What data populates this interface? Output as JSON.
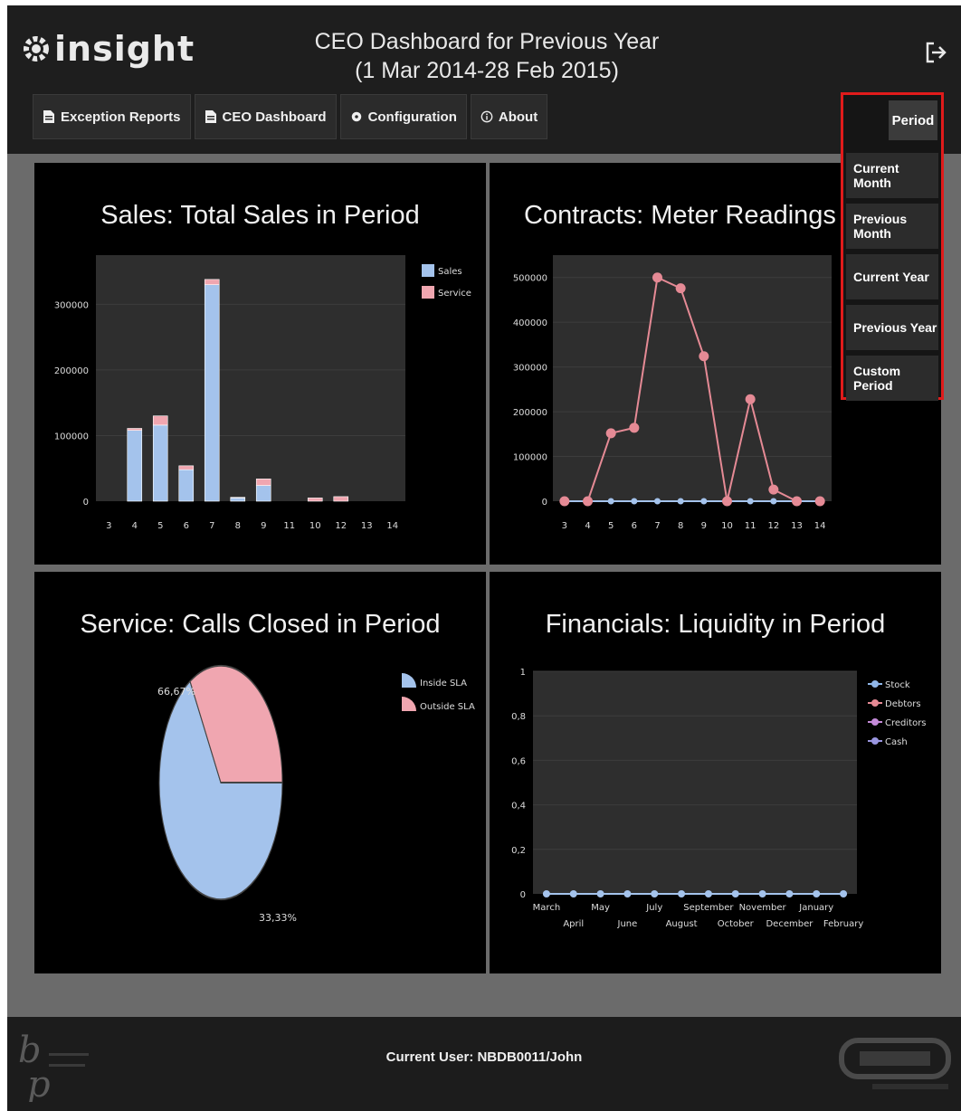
{
  "header": {
    "logo": "insight",
    "title_line1": "CEO Dashboard for Previous Year",
    "title_line2": "(1 Mar 2014-28 Feb 2015)"
  },
  "nav": [
    {
      "label": "Exception Reports",
      "icon": "document-icon"
    },
    {
      "label": "CEO Dashboard",
      "icon": "document-icon"
    },
    {
      "label": "Configuration",
      "icon": "gear-icon"
    },
    {
      "label": "About",
      "icon": "info-icon"
    }
  ],
  "period": {
    "label": "Period",
    "options": [
      "Current Month",
      "Previous Month",
      "Current Year",
      "Previous Year",
      "Custom Period"
    ]
  },
  "colors": {
    "blue": "#a4c3ec",
    "pink": "#f0a6b0",
    "pink_line": "#e58a95",
    "grid_bg": "#2e2e2e",
    "highlight": "#e01b1b"
  },
  "footer": {
    "user": "Current User: NBDB0011/John"
  },
  "chart_data": [
    {
      "type": "bar",
      "title": "Sales: Total Sales in Period",
      "categories": [
        "3",
        "4",
        "5",
        "6",
        "7",
        "8",
        "9",
        "11",
        "10",
        "12",
        "13",
        "14"
      ],
      "series": [
        {
          "name": "Sales",
          "values": [
            0,
            108000,
            116000,
            48000,
            330000,
            5000,
            24000,
            0,
            0,
            0,
            0,
            0
          ]
        },
        {
          "name": "Service",
          "values": [
            0,
            3000,
            14000,
            6000,
            8000,
            1000,
            10000,
            0,
            5000,
            7000,
            0,
            0
          ]
        }
      ],
      "yticks": [
        "0",
        "100000",
        "200000",
        "300000"
      ],
      "ylim": [
        0,
        375000
      ],
      "stacked": true,
      "legend": "top-right"
    },
    {
      "type": "line",
      "title": "Contracts: Meter Readings in Curren",
      "categories": [
        "3",
        "4",
        "5",
        "6",
        "7",
        "8",
        "9",
        "10",
        "11",
        "12",
        "13",
        "14"
      ],
      "series": [
        {
          "name": "",
          "color": "pink",
          "values": [
            0,
            0,
            152000,
            164000,
            500000,
            476000,
            324000,
            0,
            228000,
            26000,
            0,
            0
          ]
        },
        {
          "name": "",
          "color": "blue",
          "values": [
            0,
            0,
            0,
            0,
            0,
            0,
            0,
            0,
            0,
            0,
            0,
            0
          ]
        }
      ],
      "yticks": [
        "0",
        "100000",
        "200000",
        "300000",
        "400000",
        "500000"
      ],
      "ylim": [
        0,
        550000
      ]
    },
    {
      "type": "pie",
      "title": "Service: Calls Closed in Period",
      "slices": [
        {
          "name": "Inside SLA",
          "value": 66.67,
          "label": "66,67%"
        },
        {
          "name": "Outside SLA",
          "value": 33.33,
          "label": "33,33%"
        }
      ],
      "legend": "top-right"
    },
    {
      "type": "line",
      "title": "Financials: Liquidity in Period",
      "categories": [
        "March",
        "April",
        "May",
        "June",
        "July",
        "August",
        "September",
        "October",
        "November",
        "December",
        "January",
        "February"
      ],
      "series": [
        {
          "name": "Stock",
          "values": [
            0,
            0,
            0,
            0,
            0,
            0,
            0,
            0,
            0,
            0,
            0,
            0
          ]
        },
        {
          "name": "Debtors",
          "values": [
            0,
            0,
            0,
            0,
            0,
            0,
            0,
            0,
            0,
            0,
            0,
            0
          ]
        },
        {
          "name": "Creditors",
          "values": [
            0,
            0,
            0,
            0,
            0,
            0,
            0,
            0,
            0,
            0,
            0,
            0
          ]
        },
        {
          "name": "Cash",
          "values": [
            0,
            0,
            0,
            0,
            0,
            0,
            0,
            0,
            0,
            0,
            0,
            0
          ]
        }
      ],
      "yticks": [
        "0",
        "0,2",
        "0,4",
        "0,6",
        "0,8",
        "1"
      ],
      "ylim": [
        0,
        1
      ],
      "legend": "top-right"
    }
  ]
}
